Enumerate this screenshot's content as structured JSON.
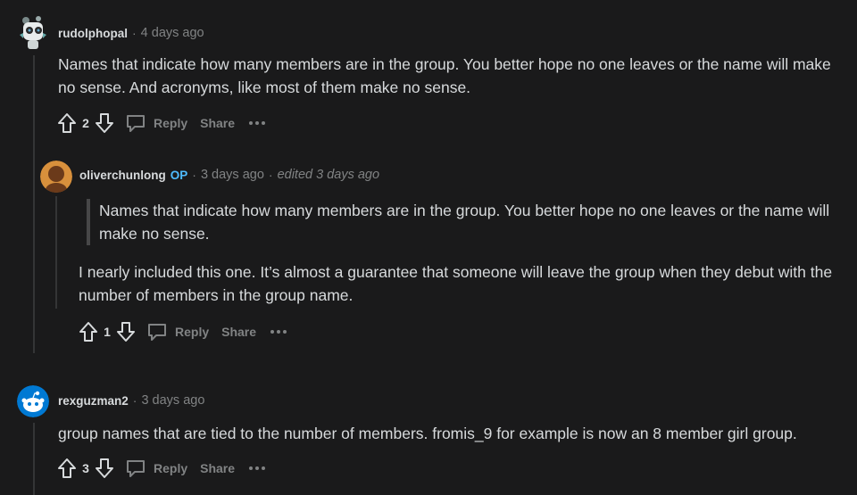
{
  "comments": [
    {
      "username": "rudolphopal",
      "time": "4 days ago",
      "body": "Names that indicate how many members are in the group. You better hope no one leaves or the name will make no sense. And acronyms, like most of them make no sense.",
      "score": "2",
      "reply_label": "Reply",
      "share_label": "Share",
      "avatar_icon": "robot-avatar-icon"
    },
    {
      "username": "oliverchunlong",
      "op_badge": "OP",
      "time": "3 days ago",
      "edited": "edited 3 days ago",
      "quote": "Names that indicate how many members are in the group. You better hope no one leaves or the name will make no sense.",
      "body": "I nearly included this one. It’s almost a guarantee that someone will leave the group when they debut with the number of members in the group name.",
      "score": "1",
      "reply_label": "Reply",
      "share_label": "Share",
      "avatar_icon": "orange-avatar-icon"
    },
    {
      "username": "rexguzman2",
      "time": "3 days ago",
      "body": "group names that are tied to the number of members. fromis_9 for example is now an 8 member girl group.",
      "score": "3",
      "reply_label": "Reply",
      "share_label": "Share",
      "avatar_icon": "snoo-avatar-icon"
    }
  ],
  "separator": "·",
  "colors": {
    "background": "#1a1a1b",
    "text": "#d7dadc",
    "muted": "#818384",
    "op_badge": "#4fbcff",
    "thread_line": "#343536"
  }
}
